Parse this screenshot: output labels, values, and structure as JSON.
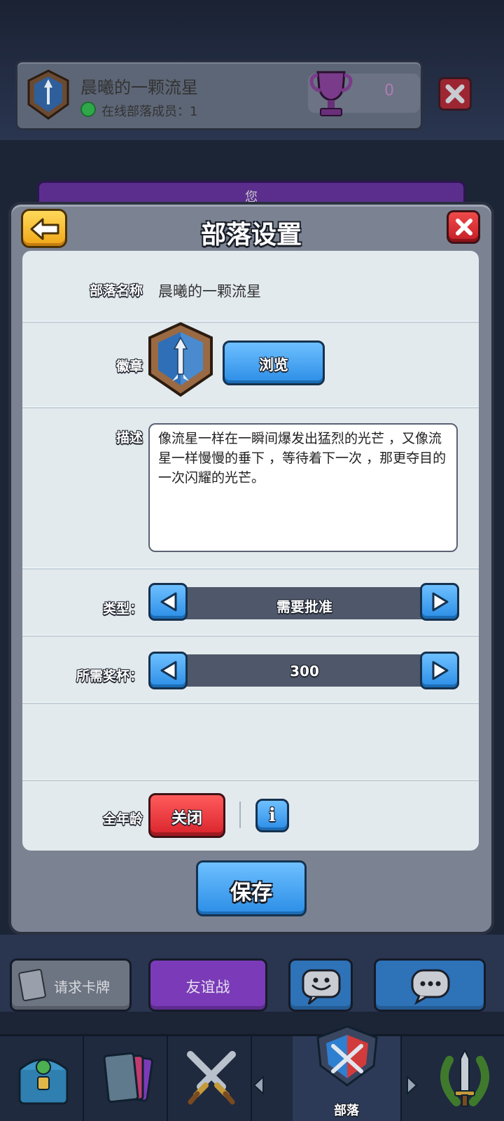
{
  "clan_header": {
    "name": "晨曦的一颗流星",
    "online_text": "在线部落成员：1",
    "trophies": "0"
  },
  "background_banner": {
    "label": "您"
  },
  "modal": {
    "title": "部落设置",
    "clan_name_label": "部落名称",
    "clan_name_value": "晨曦的一颗流星",
    "badge_label": "徽章",
    "browse_label": "浏览",
    "description_label": "描述",
    "description_value": "像流星一样在一瞬间爆发出猛烈的光芒 ，又像流星一样慢慢的垂下 ，等待着下一次 ，那更夺目的一次闪耀的光芒。",
    "type_label": "类型：",
    "type_value": "需要批准",
    "required_trophies_label": "所需奖杯：",
    "required_trophies_value": "300",
    "all_ages_label": "全年龄",
    "all_ages_value": "关闭",
    "info_label": "i",
    "save_label": "保存"
  },
  "action_bar": {
    "request_cards_label": "请求卡牌",
    "friendly_battle_label": "友谊战"
  },
  "nav": {
    "items": [
      "shop",
      "cards",
      "battle",
      "clan",
      "events"
    ],
    "active": "clan",
    "active_label": "部落"
  },
  "colors": {
    "blue_button": "#2b8de6",
    "red_button": "#d9232c",
    "yellow_button": "#f0a517",
    "purple_button": "#7b3bb8",
    "panel": "#e3eaee"
  }
}
